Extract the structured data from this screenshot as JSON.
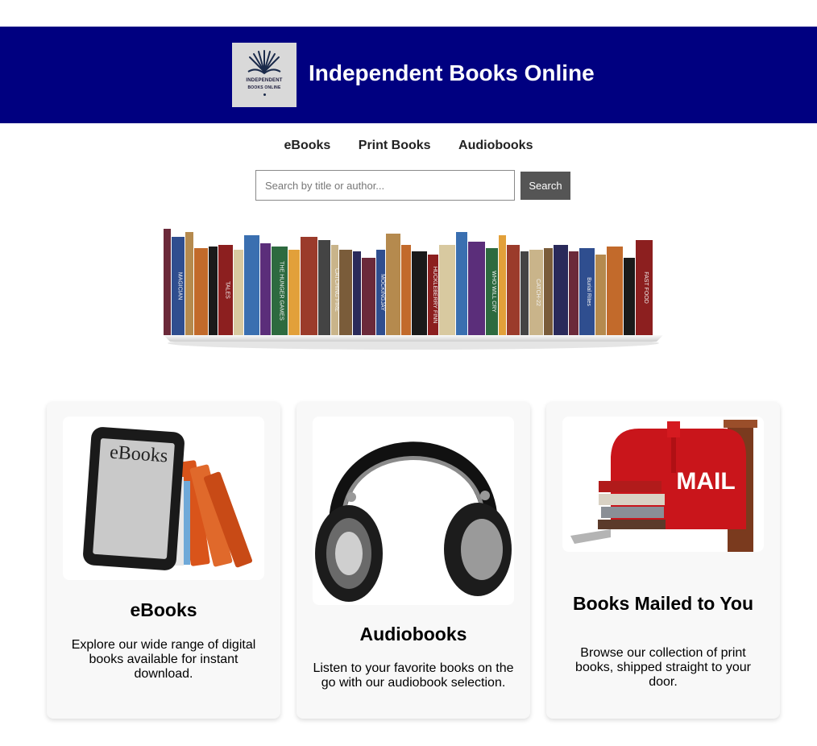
{
  "header": {
    "logo_line1": "INDEPENDENT",
    "logo_line2": "BOOKS ONLINE",
    "title": "Independent Books Online"
  },
  "nav": [
    "eBooks",
    "Print Books",
    "Audiobooks"
  ],
  "search": {
    "placeholder": "Search by title or author...",
    "button_label": "Search"
  },
  "hero": {
    "spine_texts": [
      "MAGICIAN",
      "TALES",
      "THE HUNGER GAMES",
      "CATCHING FIRE",
      "MOCKINGJAY",
      "HUCKLEBERRY FINN",
      "WHO WILL CRY",
      "CATCH-22",
      "Burial Rites",
      "FAST FOOD"
    ]
  },
  "cards": [
    {
      "image_label": "eBooks",
      "title": "eBooks",
      "description": "Explore our wide range of digital books available for instant download."
    },
    {
      "title": "Audiobooks",
      "description": "Listen to your favorite books on the go with our audiobook selection."
    },
    {
      "image_label": "MAIL",
      "title": "Books Mailed to You",
      "description": "Browse our collection of print books, shipped straight to your door."
    }
  ],
  "colors": {
    "header_bg": "#000080",
    "button_bg": "#555555",
    "card_bg": "#f8f8f8"
  }
}
